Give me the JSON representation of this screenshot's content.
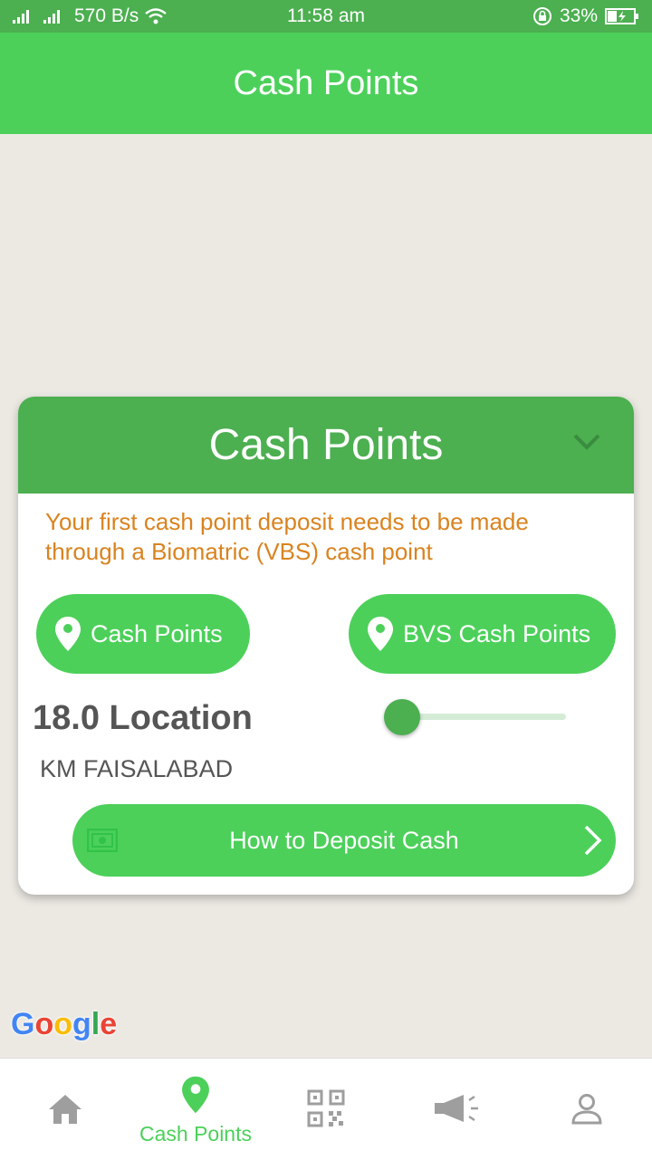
{
  "status_bar": {
    "net_speed": "570 B/s",
    "time": "11:58 am",
    "battery": "33%"
  },
  "app_bar": {
    "title": "Cash Points"
  },
  "card": {
    "title": "Cash Points",
    "notice": "Your first cash point deposit needs to be made through a Biomatric (VBS) cash point",
    "buttons": {
      "cash_points": "Cash Points",
      "bvs_cash_points": "BVS Cash Points"
    },
    "location": "18.0 Location",
    "city": "KM FAISALABAD",
    "slider_value": 0,
    "deposit_button": "How to Deposit Cash"
  },
  "map": {
    "logo": "Google"
  },
  "bottom_nav": {
    "items": [
      {
        "icon": "home-icon",
        "label": ""
      },
      {
        "icon": "location-pin-icon",
        "label": "Cash Points"
      },
      {
        "icon": "qr-code-icon",
        "label": ""
      },
      {
        "icon": "megaphone-icon",
        "label": ""
      },
      {
        "icon": "person-icon",
        "label": ""
      }
    ]
  },
  "colors": {
    "primary": "#4caf50",
    "accent": "#4cd05a",
    "notice": "#d9831f"
  }
}
